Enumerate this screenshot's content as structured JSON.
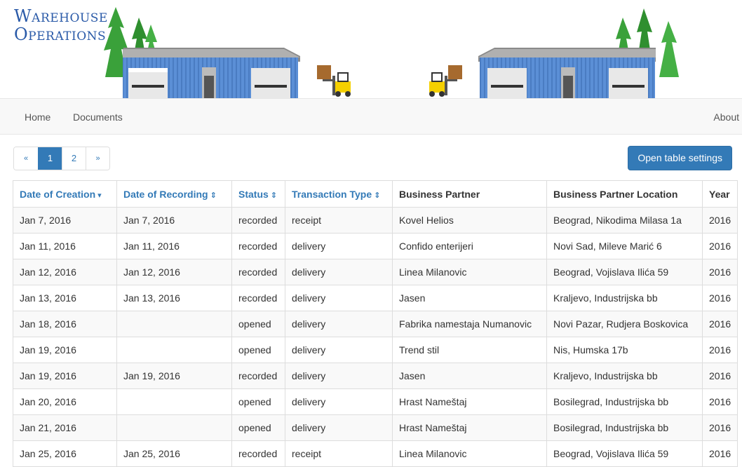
{
  "header": {
    "title_line1": "Warehouse",
    "title_line2": "Operations"
  },
  "nav": {
    "home": "Home",
    "documents": "Documents",
    "about": "About"
  },
  "pagination": {
    "prev": "«",
    "pages": [
      "1",
      "2"
    ],
    "next": "»",
    "current": "1"
  },
  "toolbar": {
    "settings_label": "Open table settings"
  },
  "table": {
    "columns": [
      {
        "label": "Date of Creation",
        "sort_icon": "▾"
      },
      {
        "label": "Date of Recording",
        "sort_icon": "⇕"
      },
      {
        "label": "Status",
        "sort_icon": "⇕"
      },
      {
        "label": "Transaction Type",
        "sort_icon": "⇕"
      },
      {
        "label": "Business Partner"
      },
      {
        "label": "Business Partner Location"
      },
      {
        "label": "Year"
      }
    ],
    "rows": [
      [
        "Jan 7, 2016",
        "Jan 7, 2016",
        "recorded",
        "receipt",
        "Kovel Helios",
        "Beograd, Nikodima Milasa 1a",
        "2016"
      ],
      [
        "Jan 11, 2016",
        "Jan 11, 2016",
        "recorded",
        "delivery",
        "Confido enterijeri",
        "Novi Sad, Mileve Marić 6",
        "2016"
      ],
      [
        "Jan 12, 2016",
        "Jan 12, 2016",
        "recorded",
        "delivery",
        "Linea Milanovic",
        "Beograd, Vojislava Ilića 59",
        "2016"
      ],
      [
        "Jan 13, 2016",
        "Jan 13, 2016",
        "recorded",
        "delivery",
        "Jasen",
        "Kraljevo, Industrijska bb",
        "2016"
      ],
      [
        "Jan 18, 2016",
        "",
        "opened",
        "delivery",
        "Fabrika namestaja Numanovic",
        "Novi Pazar, Rudjera Boskovica",
        "2016"
      ],
      [
        "Jan 19, 2016",
        "",
        "opened",
        "delivery",
        "Trend stil",
        "Nis, Humska 17b",
        "2016"
      ],
      [
        "Jan 19, 2016",
        "Jan 19, 2016",
        "recorded",
        "delivery",
        "Jasen",
        "Kraljevo, Industrijska bb",
        "2016"
      ],
      [
        "Jan 20, 2016",
        "",
        "opened",
        "delivery",
        "Hrast Nameštaj",
        "Bosilegrad, Industrijska bb",
        "2016"
      ],
      [
        "Jan 21, 2016",
        "",
        "opened",
        "delivery",
        "Hrast Nameštaj",
        "Bosilegrad, Industrijska bb",
        "2016"
      ],
      [
        "Jan 25, 2016",
        "Jan 25, 2016",
        "recorded",
        "receipt",
        "Linea Milanovic",
        "Beograd, Vojislava Ilića 59",
        "2016"
      ]
    ]
  },
  "colors": {
    "accent": "#337ab7",
    "title": "#2a5aa8",
    "warehouse_wall": "#5b8fd6",
    "tree": "#3aa13a",
    "forklift": "#f5d000"
  },
  "icons": {
    "sort_desc": "caret-down-icon",
    "sort_both": "sort-icon",
    "prev": "chevron-double-left-icon",
    "next": "chevron-double-right-icon"
  }
}
